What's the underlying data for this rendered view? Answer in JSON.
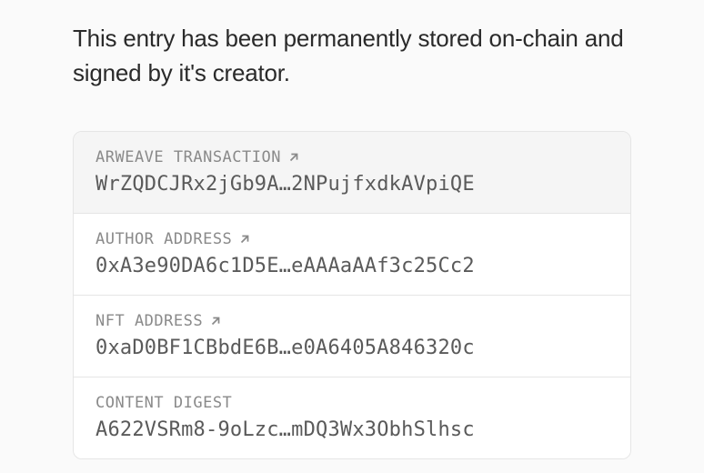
{
  "description": "This entry has been permanently stored on-chain and signed by it's creator.",
  "rows": [
    {
      "label": "ARWEAVE TRANSACTION",
      "value": "WrZQDCJRx2jGb9A…2NPujfxdkAVpiQE",
      "hasLink": true,
      "highlighted": true
    },
    {
      "label": "AUTHOR ADDRESS",
      "value": "0xA3e90DA6c1D5E…eAAAaAAf3c25Cc2",
      "hasLink": true,
      "highlighted": false
    },
    {
      "label": "NFT ADDRESS",
      "value": "0xaD0BF1CBbdE6B…e0A6405A846320c",
      "hasLink": true,
      "highlighted": false
    },
    {
      "label": "CONTENT DIGEST",
      "value": "A622VSRm8-9oLzc…mDQ3Wx3ObhSlhsc",
      "hasLink": false,
      "highlighted": false
    }
  ]
}
